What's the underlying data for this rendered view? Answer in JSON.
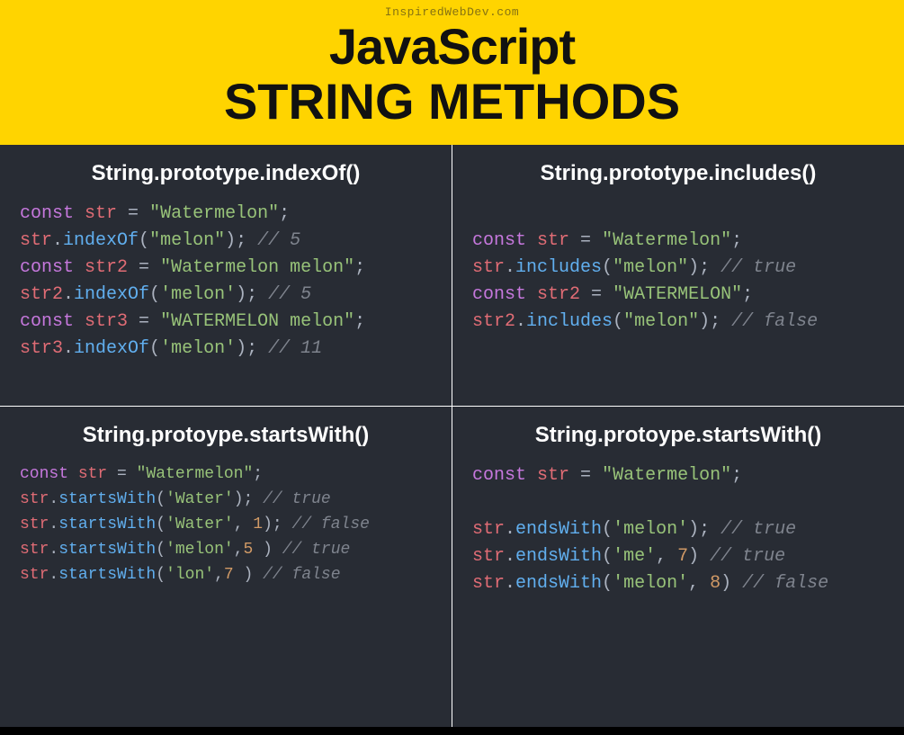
{
  "header": {
    "source": "InspiredWebDev.com",
    "title_1": "JavaScript",
    "title_2": "STRING METHODS"
  },
  "cells": [
    {
      "title": "String.prototype.indexOf()",
      "small": false,
      "lines": [
        [
          [
            "kw",
            "const"
          ],
          [
            "op",
            " "
          ],
          [
            "var",
            "str"
          ],
          [
            "op",
            " = "
          ],
          [
            "str",
            "\"Watermelon\""
          ],
          [
            "op",
            ";"
          ]
        ],
        [
          [
            "var",
            "str"
          ],
          [
            "op",
            "."
          ],
          [
            "fn",
            "indexOf"
          ],
          [
            "op",
            "("
          ],
          [
            "str",
            "\"melon\""
          ],
          [
            "op",
            "); "
          ],
          [
            "cmt",
            "// 5"
          ]
        ],
        [
          [
            "kw",
            "const"
          ],
          [
            "op",
            " "
          ],
          [
            "var",
            "str2"
          ],
          [
            "op",
            " = "
          ],
          [
            "str",
            "\"Watermelon melon\""
          ],
          [
            "op",
            ";"
          ]
        ],
        [
          [
            "var",
            "str2"
          ],
          [
            "op",
            "."
          ],
          [
            "fn",
            "indexOf"
          ],
          [
            "op",
            "("
          ],
          [
            "str",
            "'melon'"
          ],
          [
            "op",
            "); "
          ],
          [
            "cmt",
            "// 5"
          ]
        ],
        [
          [
            "kw",
            "const"
          ],
          [
            "op",
            " "
          ],
          [
            "var",
            "str3"
          ],
          [
            "op",
            " = "
          ],
          [
            "str",
            "\"WATERMELON melon\""
          ],
          [
            "op",
            ";"
          ]
        ],
        [
          [
            "var",
            "str3"
          ],
          [
            "op",
            "."
          ],
          [
            "fn",
            "indexOf"
          ],
          [
            "op",
            "("
          ],
          [
            "str",
            "'melon'"
          ],
          [
            "op",
            "); "
          ],
          [
            "cmt",
            "// 11"
          ]
        ]
      ]
    },
    {
      "title": "String.prototype.includes()",
      "small": false,
      "lines": [
        [],
        [
          [
            "kw",
            "const"
          ],
          [
            "op",
            " "
          ],
          [
            "var",
            "str"
          ],
          [
            "op",
            " = "
          ],
          [
            "str",
            "\"Watermelon\""
          ],
          [
            "op",
            ";"
          ]
        ],
        [
          [
            "var",
            "str"
          ],
          [
            "op",
            "."
          ],
          [
            "fn",
            "includes"
          ],
          [
            "op",
            "("
          ],
          [
            "str",
            "\"melon\""
          ],
          [
            "op",
            "); "
          ],
          [
            "cmt",
            "// true"
          ]
        ],
        [
          [
            "kw",
            "const"
          ],
          [
            "op",
            " "
          ],
          [
            "var",
            "str2"
          ],
          [
            "op",
            " = "
          ],
          [
            "str",
            "\"WATERMELON\""
          ],
          [
            "op",
            ";"
          ]
        ],
        [
          [
            "var",
            "str2"
          ],
          [
            "op",
            "."
          ],
          [
            "fn",
            "includes"
          ],
          [
            "op",
            "("
          ],
          [
            "str",
            "\"melon\""
          ],
          [
            "op",
            "); "
          ],
          [
            "cmt",
            "// false"
          ]
        ]
      ]
    },
    {
      "title": "String.protoype.startsWith()",
      "small": true,
      "lines": [
        [
          [
            "kw",
            "const"
          ],
          [
            "op",
            " "
          ],
          [
            "var",
            "str"
          ],
          [
            "op",
            " = "
          ],
          [
            "str",
            "\"Watermelon\""
          ],
          [
            "op",
            ";"
          ]
        ],
        [
          [
            "var",
            "str"
          ],
          [
            "op",
            "."
          ],
          [
            "fn",
            "startsWith"
          ],
          [
            "op",
            "("
          ],
          [
            "str",
            "'Water'"
          ],
          [
            "op",
            "); "
          ],
          [
            "cmt",
            "// true"
          ]
        ],
        [
          [
            "var",
            "str"
          ],
          [
            "op",
            "."
          ],
          [
            "fn",
            "startsWith"
          ],
          [
            "op",
            "("
          ],
          [
            "str",
            "'Water'"
          ],
          [
            "op",
            ", "
          ],
          [
            "num",
            "1"
          ],
          [
            "op",
            "); "
          ],
          [
            "cmt",
            "// false"
          ]
        ],
        [
          [
            "var",
            "str"
          ],
          [
            "op",
            "."
          ],
          [
            "fn",
            "startsWith"
          ],
          [
            "op",
            "("
          ],
          [
            "str",
            "'melon'"
          ],
          [
            "op",
            ","
          ],
          [
            "num",
            "5"
          ],
          [
            "op",
            " ) "
          ],
          [
            "cmt",
            "// true"
          ]
        ],
        [
          [
            "var",
            "str"
          ],
          [
            "op",
            "."
          ],
          [
            "fn",
            "startsWith"
          ],
          [
            "op",
            "("
          ],
          [
            "str",
            "'lon'"
          ],
          [
            "op",
            ","
          ],
          [
            "num",
            "7"
          ],
          [
            "op",
            " ) "
          ],
          [
            "cmt",
            "// false"
          ]
        ]
      ]
    },
    {
      "title": "String.protoype.startsWith()",
      "small": false,
      "lines": [
        [
          [
            "kw",
            "const"
          ],
          [
            "op",
            " "
          ],
          [
            "var",
            "str"
          ],
          [
            "op",
            " = "
          ],
          [
            "str",
            "\"Watermelon\""
          ],
          [
            "op",
            ";"
          ]
        ],
        [],
        [
          [
            "var",
            "str"
          ],
          [
            "op",
            "."
          ],
          [
            "fn",
            "endsWith"
          ],
          [
            "op",
            "("
          ],
          [
            "str",
            "'melon'"
          ],
          [
            "op",
            "); "
          ],
          [
            "cmt",
            "// true"
          ]
        ],
        [
          [
            "var",
            "str"
          ],
          [
            "op",
            "."
          ],
          [
            "fn",
            "endsWith"
          ],
          [
            "op",
            "("
          ],
          [
            "str",
            "'me'"
          ],
          [
            "op",
            ", "
          ],
          [
            "num",
            "7"
          ],
          [
            "op",
            ") "
          ],
          [
            "cmt",
            "// true"
          ]
        ],
        [
          [
            "var",
            "str"
          ],
          [
            "op",
            "."
          ],
          [
            "fn",
            "endsWith"
          ],
          [
            "op",
            "("
          ],
          [
            "str",
            "'melon'"
          ],
          [
            "op",
            ", "
          ],
          [
            "num",
            "8"
          ],
          [
            "op",
            ") "
          ],
          [
            "cmt",
            "// false"
          ]
        ]
      ]
    }
  ]
}
